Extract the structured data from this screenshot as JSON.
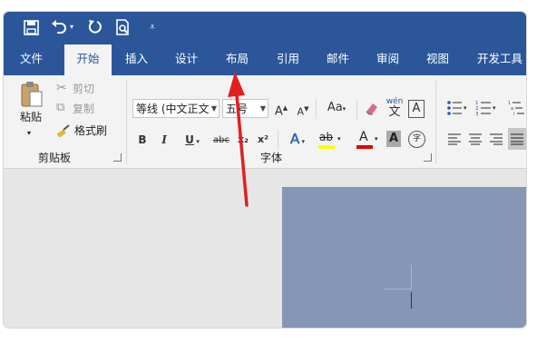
{
  "quick_access": {
    "save_icon": "save-icon",
    "undo_icon": "undo-icon",
    "redo_icon": "redo-icon",
    "print_preview_icon": "print-preview-icon",
    "customize_icon": "customize-quick-access-icon"
  },
  "tabs": [
    "文件",
    "开始",
    "插入",
    "设计",
    "布局",
    "引用",
    "邮件",
    "审阅",
    "视图",
    "开发工具"
  ],
  "active_tab": "开始",
  "clipboard": {
    "paste": "粘贴",
    "cut": "剪切",
    "copy": "复制",
    "format_painter": "格式刷",
    "group_label": "剪贴板"
  },
  "font": {
    "font_name": "等线 (中文正文",
    "font_size": "五号",
    "bold": "B",
    "italic": "I",
    "underline": "U",
    "strikethrough": "abc",
    "subscript": "x₂",
    "superscript": "x²",
    "grow": "A",
    "shrink": "A",
    "change_case": "Aa",
    "phonetic_top": "wén",
    "phonetic_bottom": "文",
    "char_border": "A",
    "text_effects": "A",
    "highlight": "ab",
    "font_color": "A",
    "char_shading": "A",
    "enclose": "字",
    "group_label": "字体"
  },
  "colors": {
    "ribbon_blue": "#2b579a",
    "highlight_yellow": "#ffff00",
    "font_red": "#e00000",
    "arrow_red": "#e02020",
    "page_blue": "#8597b5"
  }
}
